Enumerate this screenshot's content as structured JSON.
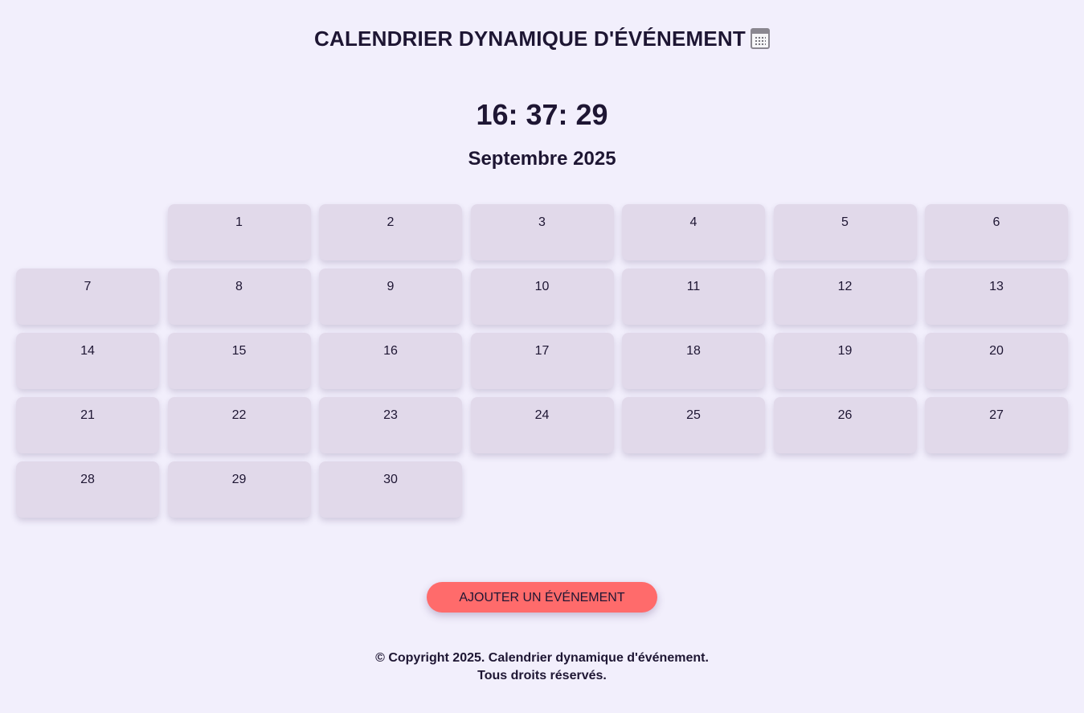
{
  "header": {
    "title": "CALENDRIER DYNAMIQUE D'ÉVÉNEMENT",
    "icon": "calendar-icon"
  },
  "clock": {
    "time": "16: 37: 29"
  },
  "calendar": {
    "month_label": "Septembre 2025",
    "leading_empty_cells": 1,
    "days": [
      "1",
      "2",
      "3",
      "4",
      "5",
      "6",
      "7",
      "8",
      "9",
      "10",
      "11",
      "12",
      "13",
      "14",
      "15",
      "16",
      "17",
      "18",
      "19",
      "20",
      "21",
      "22",
      "23",
      "24",
      "25",
      "26",
      "27",
      "28",
      "29",
      "30"
    ],
    "colors": {
      "day_bg": "#e1d9ea",
      "page_bg": "#f2effc",
      "text": "#1e1633"
    }
  },
  "actions": {
    "add_event_label": "AJOUTER UN ÉVÉNEMENT",
    "add_event_color": "#ff6b6b"
  },
  "footer": {
    "line1": "© Copyright 2025. Calendrier dynamique d'événement.",
    "line2": "Tous droits réservés."
  }
}
